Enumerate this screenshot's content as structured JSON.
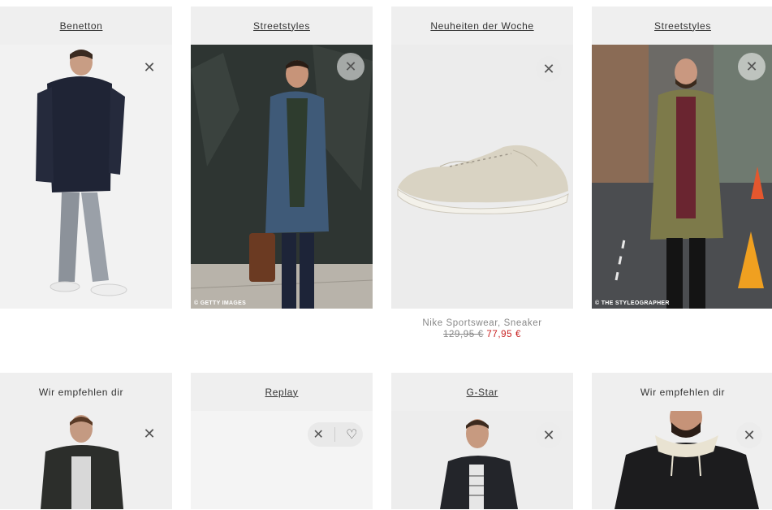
{
  "cards": [
    {
      "header": "Benetton",
      "close_icon": "✕"
    },
    {
      "header": "Streetstyles",
      "close_icon": "✕",
      "watermark": "© GETTY IMAGES"
    },
    {
      "header": "Neuheiten der Woche",
      "close_icon": "✕",
      "product": {
        "name": "Nike Sportswear, Sneaker",
        "old_price": "129,95 €",
        "new_price": "77,95 €"
      }
    },
    {
      "header": "Streetstyles",
      "close_icon": "✕",
      "watermark": "© THE STYLEOGRAPHER"
    },
    {
      "header": "Wir empfehlen dir",
      "close_icon": "✕"
    },
    {
      "header": "Replay",
      "close_icon": "✕",
      "heart_icon": "♡"
    },
    {
      "header": "G-Star",
      "close_icon": "✕"
    },
    {
      "header": "Wir empfehlen dir",
      "close_icon": "✕"
    }
  ],
  "colors": {
    "header_bg": "#efefef",
    "sale_price": "#c81e1e",
    "muted_text": "#888888"
  }
}
